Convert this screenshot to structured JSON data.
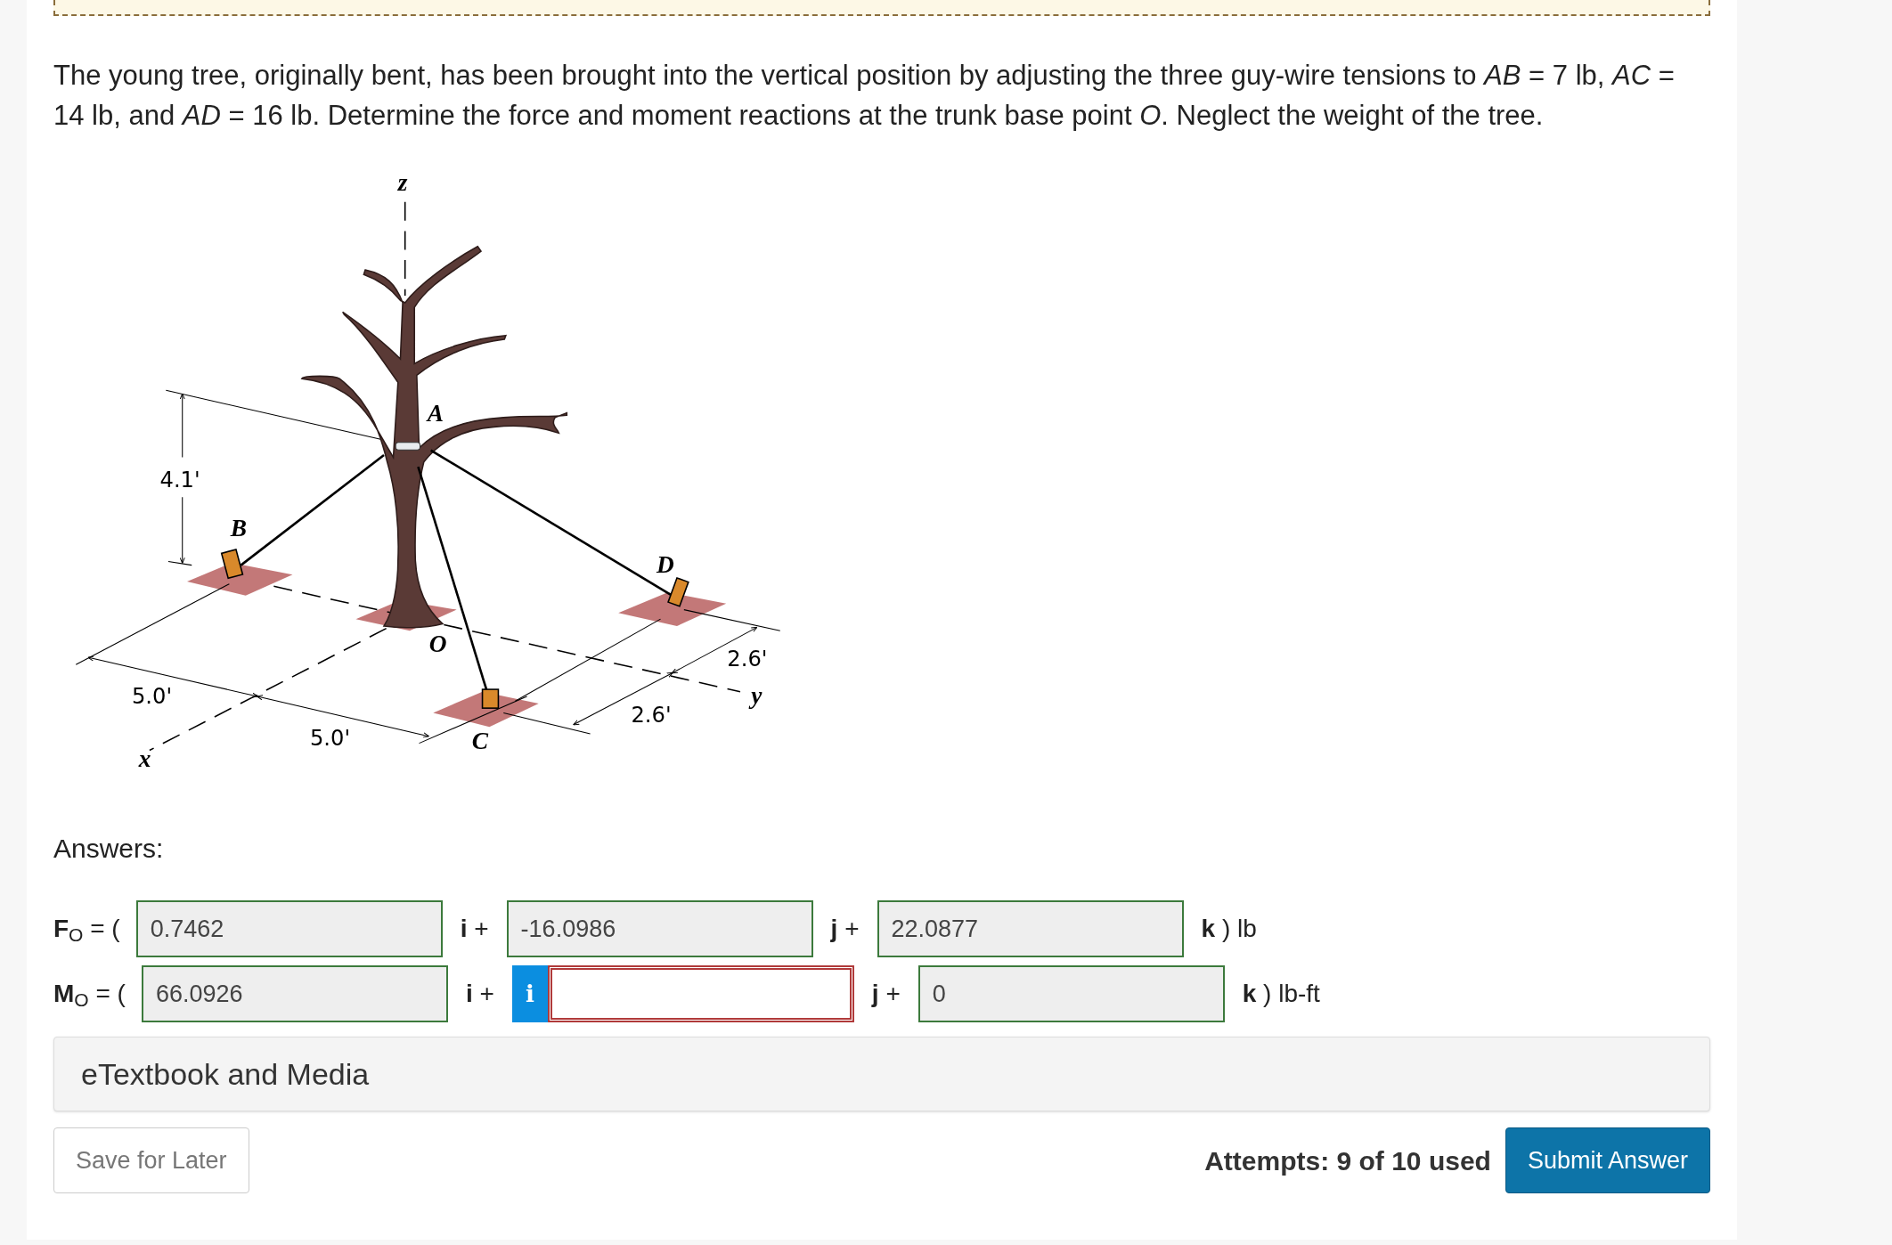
{
  "problem": {
    "text": "The young tree, originally bent, has been brought into the vertical position by adjusting the three guy-wire tensions to *AB* = 7 lb, *AC* = 14 lb, and *AD* = 16 lb. Determine the force and moment reactions at the trunk base point *O*. Neglect the weight of the tree."
  },
  "figure": {
    "labels": [
      {
        "kind": "axis",
        "text": "z"
      },
      {
        "kind": "point",
        "text": "A"
      },
      {
        "kind": "point",
        "text": "B"
      },
      {
        "kind": "point",
        "text": "D"
      },
      {
        "kind": "point",
        "text": "O"
      },
      {
        "kind": "point",
        "text": "C"
      },
      {
        "kind": "axis",
        "text": "x"
      },
      {
        "kind": "axis",
        "text": "y"
      },
      {
        "kind": "dimension",
        "text": "4.1'"
      },
      {
        "kind": "dimension",
        "text": "5.0'"
      },
      {
        "kind": "dimension",
        "text": "5.0'"
      },
      {
        "kind": "dimension",
        "text": "2.6'"
      },
      {
        "kind": "dimension",
        "text": "2.6'"
      }
    ]
  },
  "answers": {
    "heading": "Answers:",
    "rows": [
      {
        "label": "**F**$_{O}$ = (",
        "fields": [
          {
            "value": "0.7462",
            "correct": true,
            "suffix": "**i** +"
          },
          {
            "value": "-16.0986",
            "correct": true,
            "suffix": "**j** +"
          },
          {
            "value": "22.0877",
            "correct": true,
            "suffix": "**k** ) lb"
          }
        ]
      },
      {
        "label": "**M**$_{O}$ = (",
        "fields": [
          {
            "value": "66.0926",
            "correct": true,
            "suffix": "**i** +"
          },
          {
            "correct": false,
            "info_button": "i",
            "suffix": "**j** +"
          },
          {
            "value": "0",
            "correct": true,
            "suffix": "**k** ) lb-ft"
          }
        ]
      }
    ]
  },
  "etextbook": "eTextbook and Media",
  "save_button": "Save for Later",
  "attempts": "Attempts: 9 of 10 used",
  "submit_button": "Submit Answer"
}
